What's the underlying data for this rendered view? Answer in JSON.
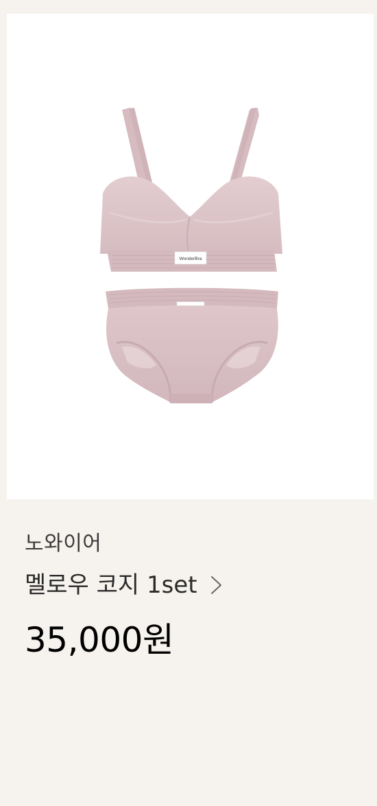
{
  "product": {
    "image": {
      "alt": "Pink bra and brief set",
      "label_text": "WonderBra"
    },
    "brand": "노와이어",
    "name": "멜로우 코지 1set",
    "price": "35,000원"
  },
  "colors": {
    "background": "#f6f3ee",
    "card": "#ffffff",
    "garment": "#dcc3c7"
  },
  "icons": {
    "detail_link": "chevron-right-icon"
  }
}
